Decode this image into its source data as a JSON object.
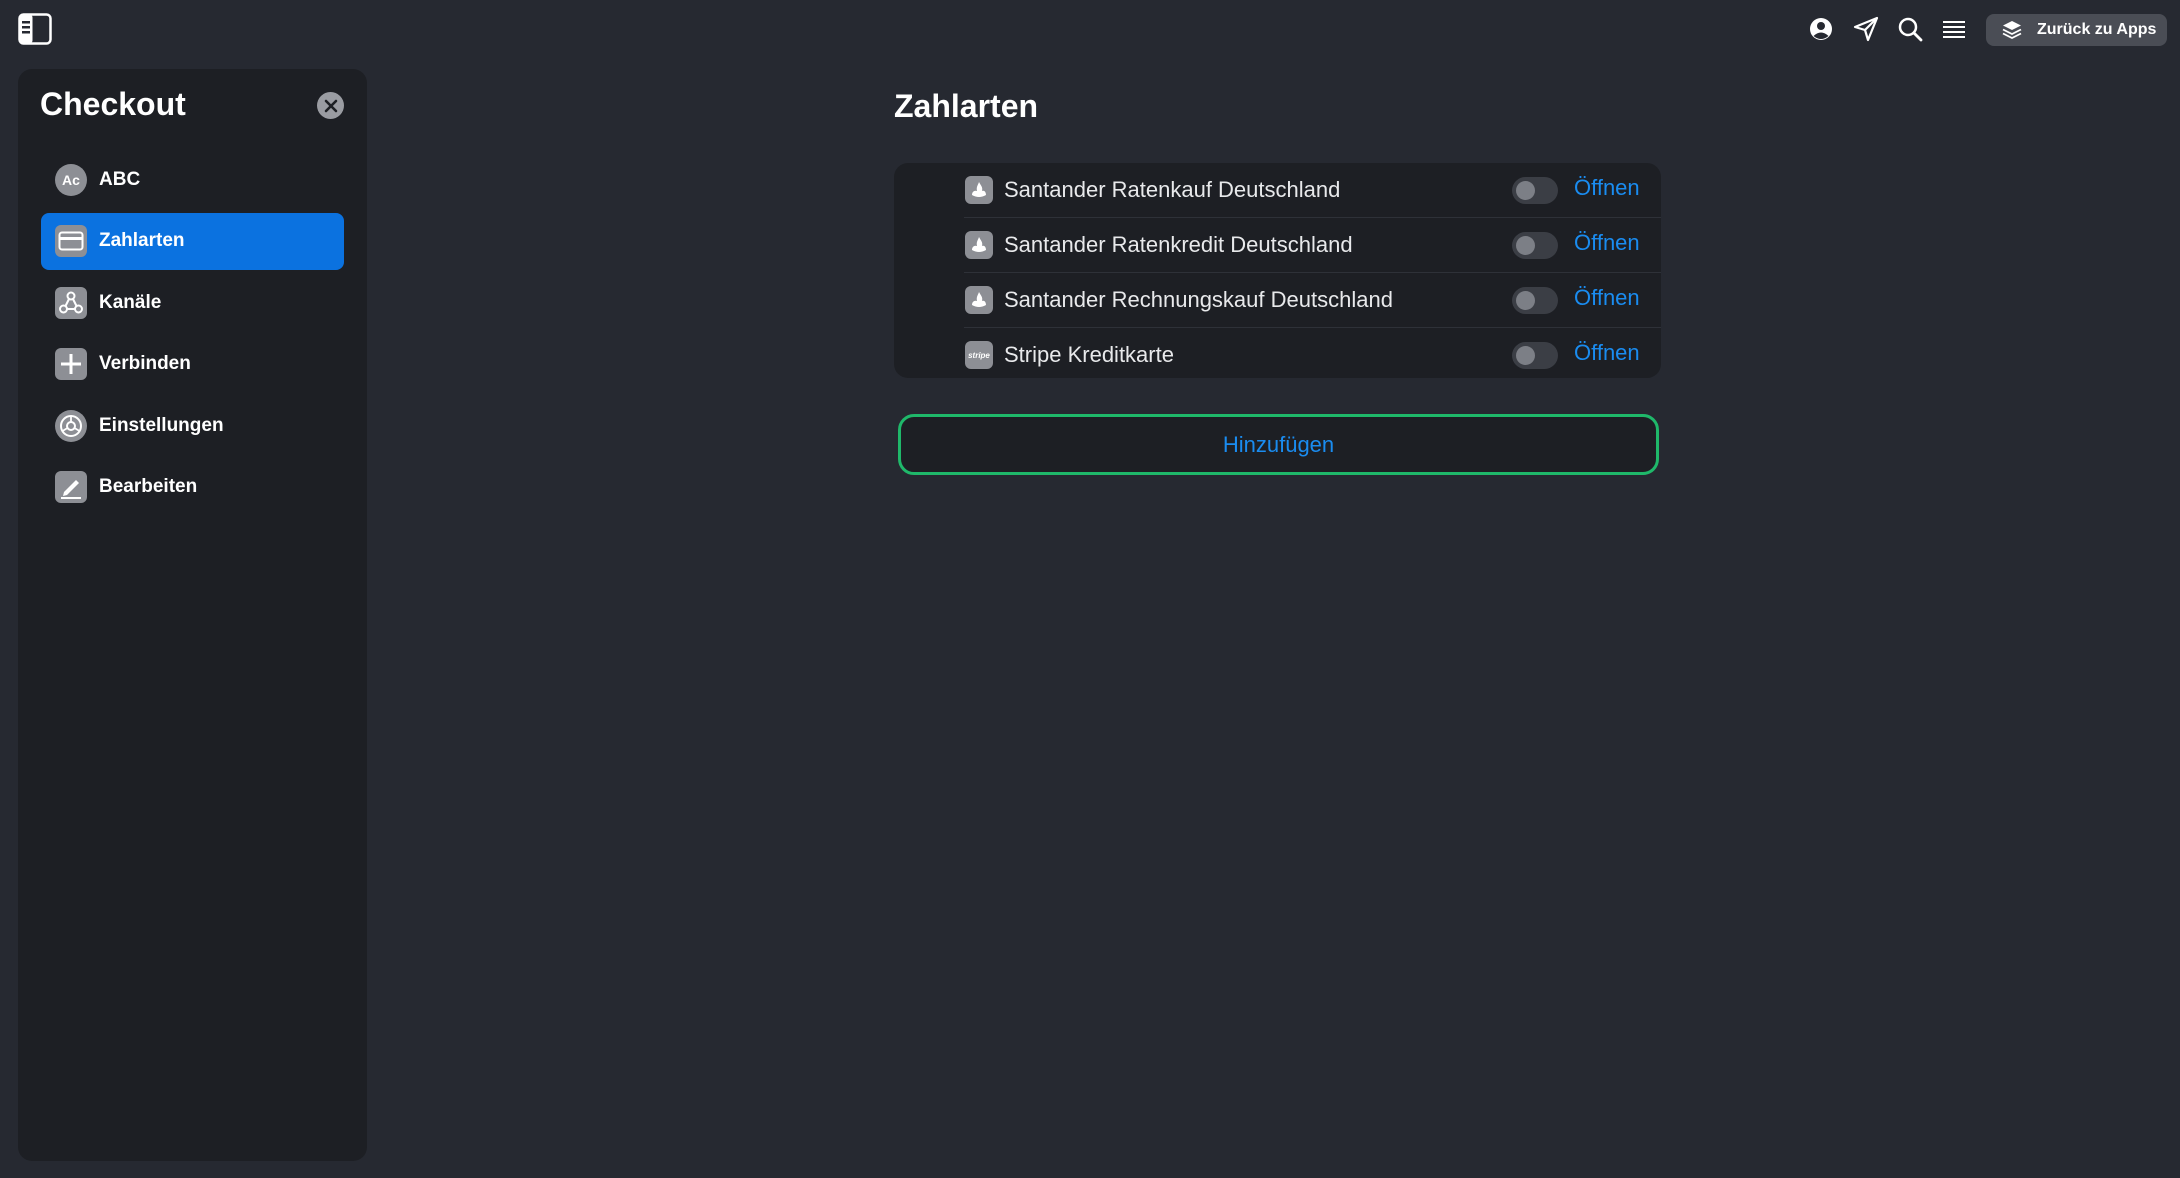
{
  "topbar": {
    "apps_button_label": "Zurück zu Apps",
    "icons": [
      "sidebar-toggle-icon",
      "account-icon",
      "send-icon",
      "search-icon",
      "menu-icon",
      "layers-icon"
    ]
  },
  "sidebar": {
    "title": "Checkout",
    "items": [
      {
        "label": "ABC",
        "icon": "avatar-icon",
        "icon_text": "Ac",
        "active": false
      },
      {
        "label": "Zahlarten",
        "icon": "credit-card-icon",
        "active": true
      },
      {
        "label": "Kanäle",
        "icon": "channels-icon",
        "active": false
      },
      {
        "label": "Verbinden",
        "icon": "plus-icon",
        "active": false
      },
      {
        "label": "Einstellungen",
        "icon": "settings-icon",
        "active": false
      },
      {
        "label": "Bearbeiten",
        "icon": "edit-icon",
        "active": false
      }
    ]
  },
  "main": {
    "title": "Zahlarten",
    "payment_methods": [
      {
        "name": "Santander Ratenkauf Deutschland",
        "icon": "santander-icon",
        "enabled": false,
        "action": "Öffnen"
      },
      {
        "name": "Santander Ratenkredit Deutschland",
        "icon": "santander-icon",
        "enabled": false,
        "action": "Öffnen"
      },
      {
        "name": "Santander Rechnungskauf Deutschland",
        "icon": "santander-icon",
        "enabled": false,
        "action": "Öffnen"
      },
      {
        "name": "Stripe Kreditkarte",
        "icon": "stripe-icon",
        "icon_text": "stripe",
        "enabled": false,
        "action": "Öffnen"
      }
    ],
    "add_button_label": "Hinzufügen"
  },
  "colors": {
    "background": "#262931",
    "panel": "#1d1f24",
    "accent_blue": "#0b72e0",
    "link_blue": "#1a8cf0",
    "add_border_green": "#1fb86a"
  }
}
